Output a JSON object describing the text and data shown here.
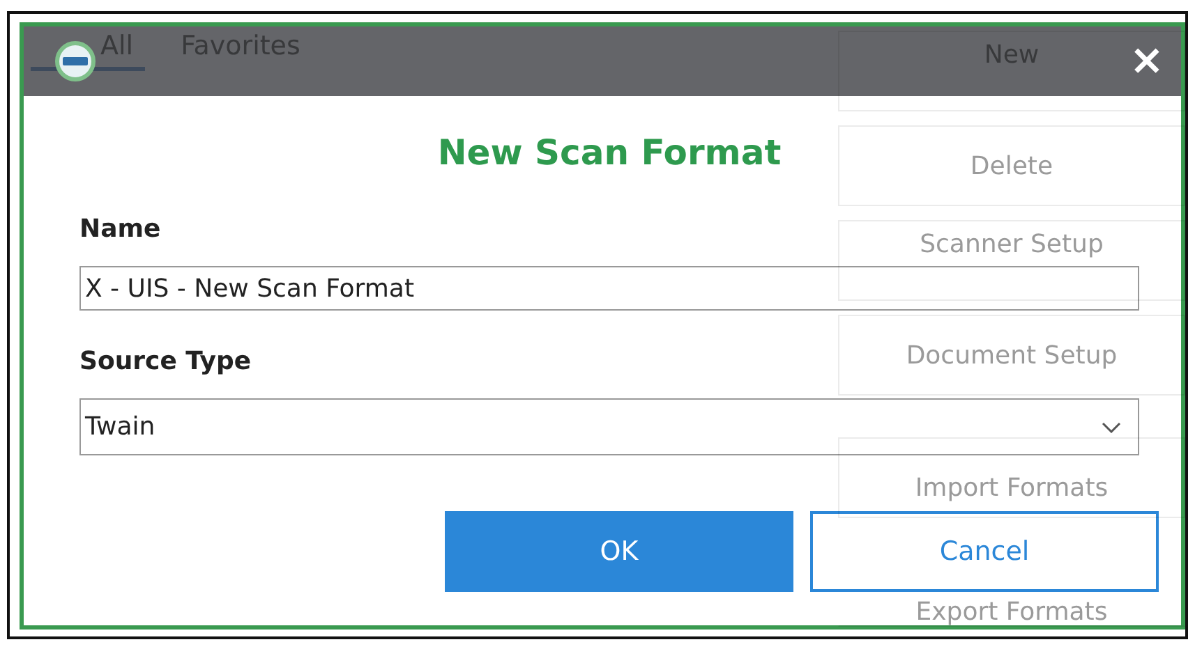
{
  "background": {
    "tabs": [
      {
        "label": "All",
        "selected": true
      },
      {
        "label": "Favorites",
        "selected": false
      }
    ],
    "buttons": [
      "New",
      "Delete",
      "Scanner Setup",
      "Document Setup",
      "Import Formats",
      "Export Formats"
    ]
  },
  "dialog": {
    "close": "×",
    "title": "New Scan Format",
    "fields": [
      {
        "kind": "text",
        "label": "Name",
        "value": "X - UIS - New Scan Format"
      },
      {
        "kind": "select",
        "label": "Source Type",
        "value": "Twain"
      }
    ],
    "buttons": [
      {
        "kind": "primary",
        "label": "OK"
      },
      {
        "kind": "secondary",
        "label": "Cancel"
      }
    ]
  }
}
